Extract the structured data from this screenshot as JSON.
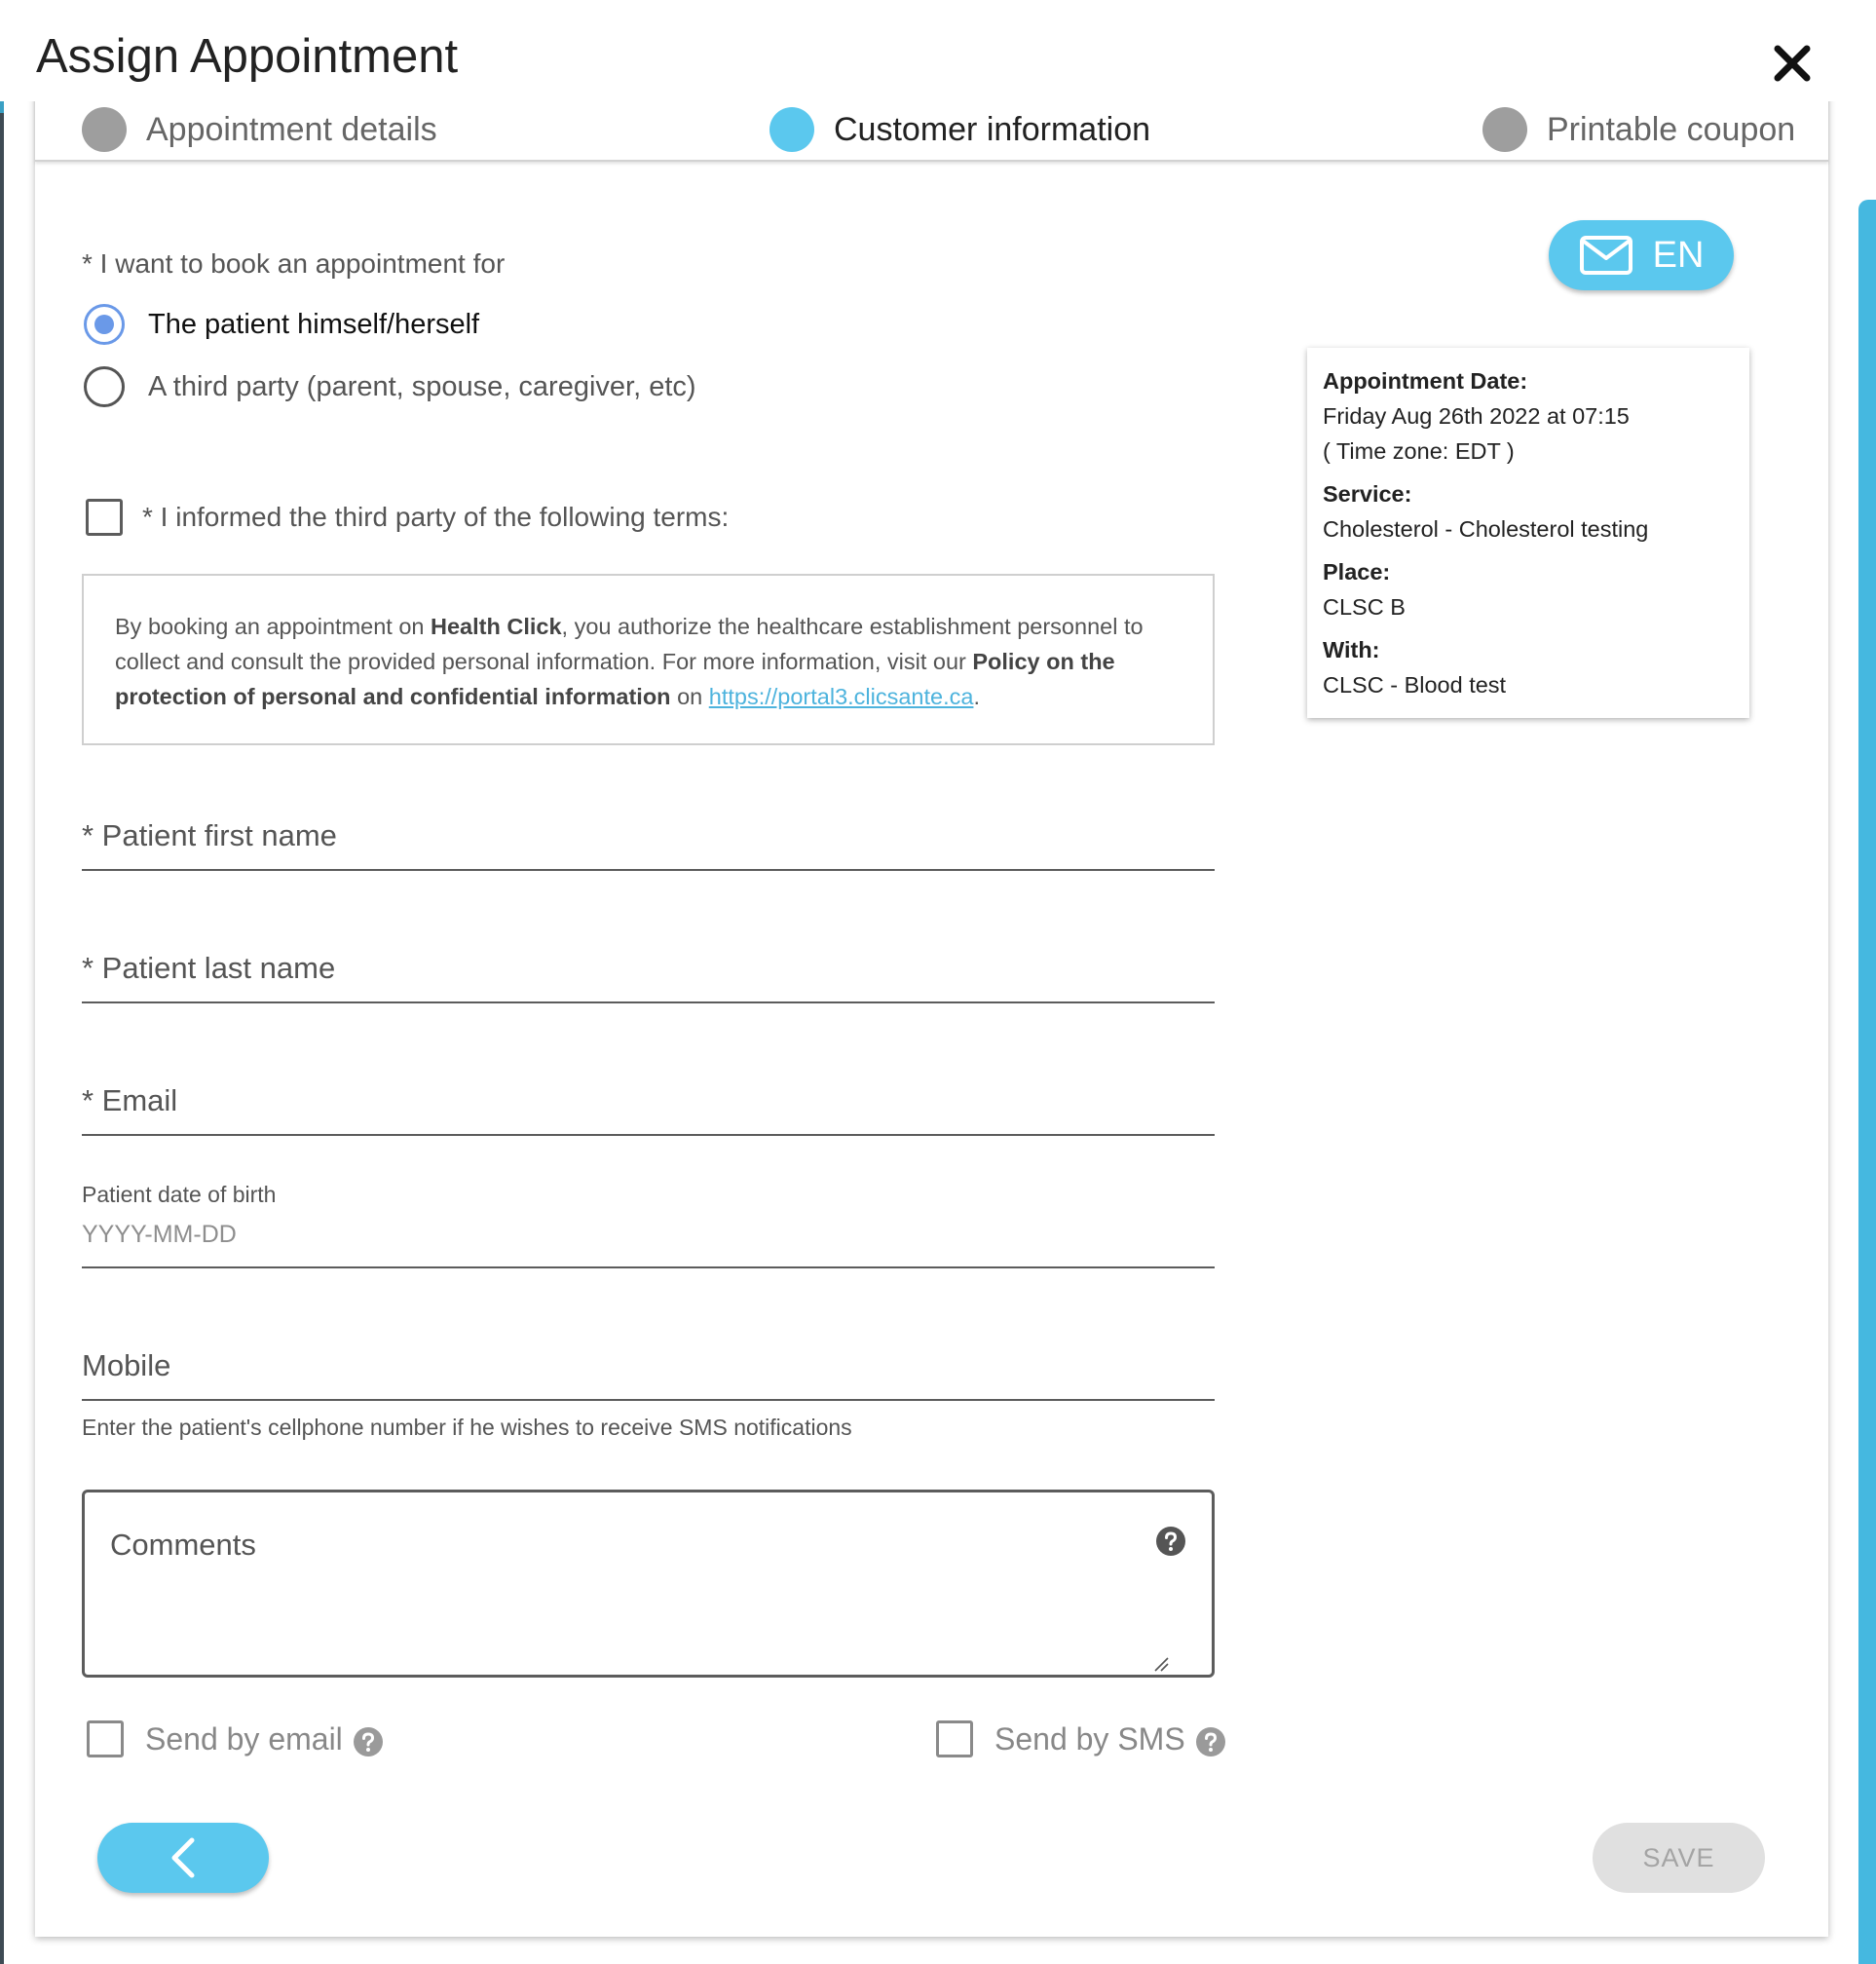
{
  "dialog": {
    "title": "Assign Appointment"
  },
  "stepper": {
    "steps": [
      {
        "label": "Appointment details",
        "state": "done"
      },
      {
        "label": "Customer information",
        "state": "active"
      },
      {
        "label": "Printable coupon",
        "state": "pending"
      }
    ]
  },
  "booking": {
    "question": "* I want to book an appointment for",
    "options": [
      {
        "label": "The patient himself/herself",
        "selected": true
      },
      {
        "label": "A third party (parent, spouse, caregiver, etc)",
        "selected": false
      }
    ]
  },
  "terms": {
    "checkbox_label": "* I informed the third party of the following terms:",
    "text_1": "By booking an appointment on ",
    "brand": "Health Click",
    "text_2": ", you authorize the healthcare establishment personnel to collect and consult the provided personal information. For more information, visit our ",
    "policy": "Policy on the protection of personal and confidential information",
    "text_3": " on ",
    "link": "https://portal3.clicsante.ca",
    "text_4": "."
  },
  "form": {
    "first_name_label": "* Patient first name",
    "last_name_label": "* Patient last name",
    "email_label": "* Email",
    "dob_label": "Patient date of birth",
    "dob_placeholder": "YYYY-MM-DD",
    "mobile_label": "Mobile",
    "mobile_hint": "Enter the patient's cellphone number if he wishes to receive SMS notifications",
    "comments_label": "Comments"
  },
  "send": {
    "email_label": "Send by email",
    "sms_label": "Send by SMS"
  },
  "buttons": {
    "save_label": "SAVE",
    "language_label": "EN"
  },
  "summary": {
    "date_key": "Appointment Date:",
    "date_value": "Friday Aug 26th 2022 at 07:15",
    "timezone": "( Time zone: EDT )",
    "service_key": "Service:",
    "service_value": "Cholesterol - Cholesterol testing",
    "place_key": "Place:",
    "place_value": "CLSC B",
    "with_key": "With:",
    "with_value": "CLSC - Blood test"
  },
  "colors": {
    "accent": "#5bc8ee",
    "radio": "#6a99e8",
    "disabled": "#e0e0e0",
    "link": "#4db3dd"
  },
  "icons": [
    "close-icon",
    "envelope-icon",
    "help-icon",
    "chevron-left-icon",
    "resize-grip-icon"
  ]
}
